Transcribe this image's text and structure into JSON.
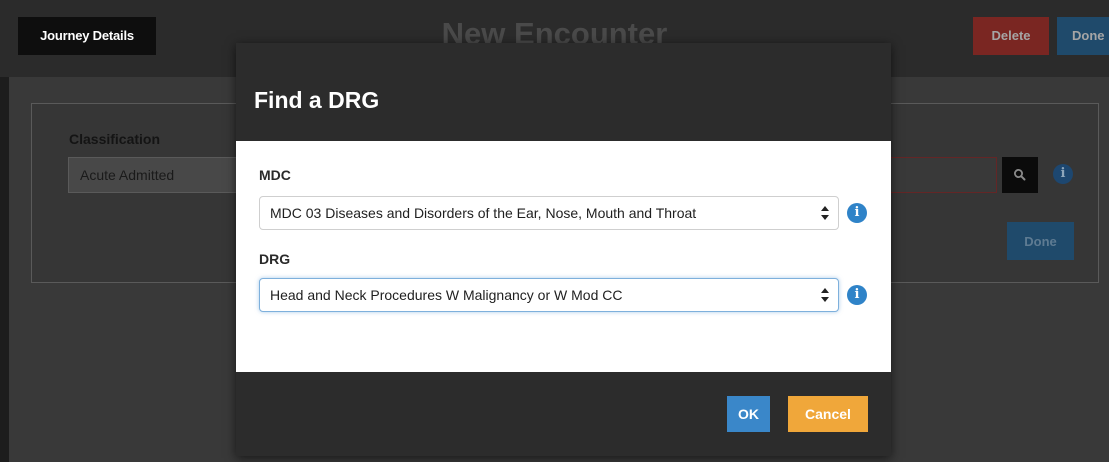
{
  "header": {
    "journey_button_label": "Journey Details",
    "page_title": "New Encounter",
    "delete_label": "Delete",
    "done_label": "Done"
  },
  "background_form": {
    "classification_label": "Classification",
    "classification_value": "Acute Admitted",
    "drg_search_value": "",
    "done_label": "Done",
    "search_icon": "search-icon",
    "info_icon": "info-icon"
  },
  "modal": {
    "title": "Find a DRG",
    "mdc": {
      "label": "MDC",
      "selected": "MDC 03 Diseases and Disorders of the Ear, Nose, Mouth and Throat"
    },
    "drg": {
      "label": "DRG",
      "selected": "Head and Neck Procedures W Malignancy or W Mod CC"
    },
    "ok_label": "OK",
    "cancel_label": "Cancel"
  },
  "colors": {
    "ok_button": "#3a87c9",
    "cancel_button": "#f0a73a",
    "info_icon": "#2f83c8",
    "delete_button": "#d9534f",
    "modal_header": "#2c2c2c"
  }
}
